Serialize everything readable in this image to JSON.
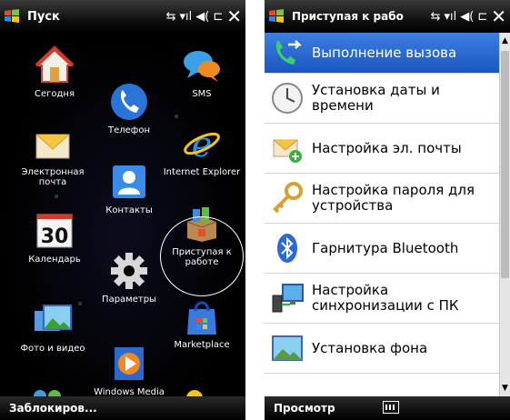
{
  "left": {
    "title": "Пуск",
    "status_icons": [
      "data-connection-icon",
      "signal-icon",
      "volume-icon",
      "battery-icon",
      "close-icon"
    ],
    "tiles": [
      {
        "label": "Сегодня",
        "icon": "house-icon"
      },
      {
        "label": "SMS",
        "icon": "speech-bubbles-icon"
      },
      {
        "label": "Телефон",
        "icon": "phone-icon"
      },
      {
        "label": "Электронная почта",
        "icon": "envelope-icon"
      },
      {
        "label": "Internet Explorer",
        "icon": "internet-explorer-icon"
      },
      {
        "label": "Контакты",
        "icon": "contact-card-icon"
      },
      {
        "label": "Календарь",
        "icon": "calendar-icon",
        "day": "30"
      },
      {
        "label": "Приступая к работе",
        "icon": "getting-started-box-icon"
      },
      {
        "label": "Параметры",
        "icon": "gear-icon"
      },
      {
        "label": "Фото и видео",
        "icon": "photos-icon"
      },
      {
        "label": "Marketplace",
        "icon": "marketplace-bag-icon"
      },
      {
        "label": "Windows Media",
        "icon": "windows-media-icon"
      }
    ],
    "softkey_left": "Заблокиров..."
  },
  "right": {
    "title": "Приступая к рабо",
    "items": [
      {
        "label": "Выполнение вызова",
        "icon": "call-arrow-icon",
        "selected": true
      },
      {
        "label": "Установка даты и времени",
        "icon": "clock-icon"
      },
      {
        "label": "Настройка эл. почты",
        "icon": "email-setup-icon"
      },
      {
        "label": "Настройка пароля для устройства",
        "icon": "key-icon"
      },
      {
        "label": "Гарнитура Bluetooth",
        "icon": "bluetooth-icon"
      },
      {
        "label": "Настройка синхронизации с ПК",
        "icon": "pc-sync-icon"
      },
      {
        "label": "Установка фона",
        "icon": "background-picture-icon"
      }
    ],
    "softkey_left": "Просмотр",
    "keyboard_icon": "keyboard-icon"
  },
  "colors": {
    "selection": "#1f5fcc",
    "titlebar": "#111111"
  }
}
